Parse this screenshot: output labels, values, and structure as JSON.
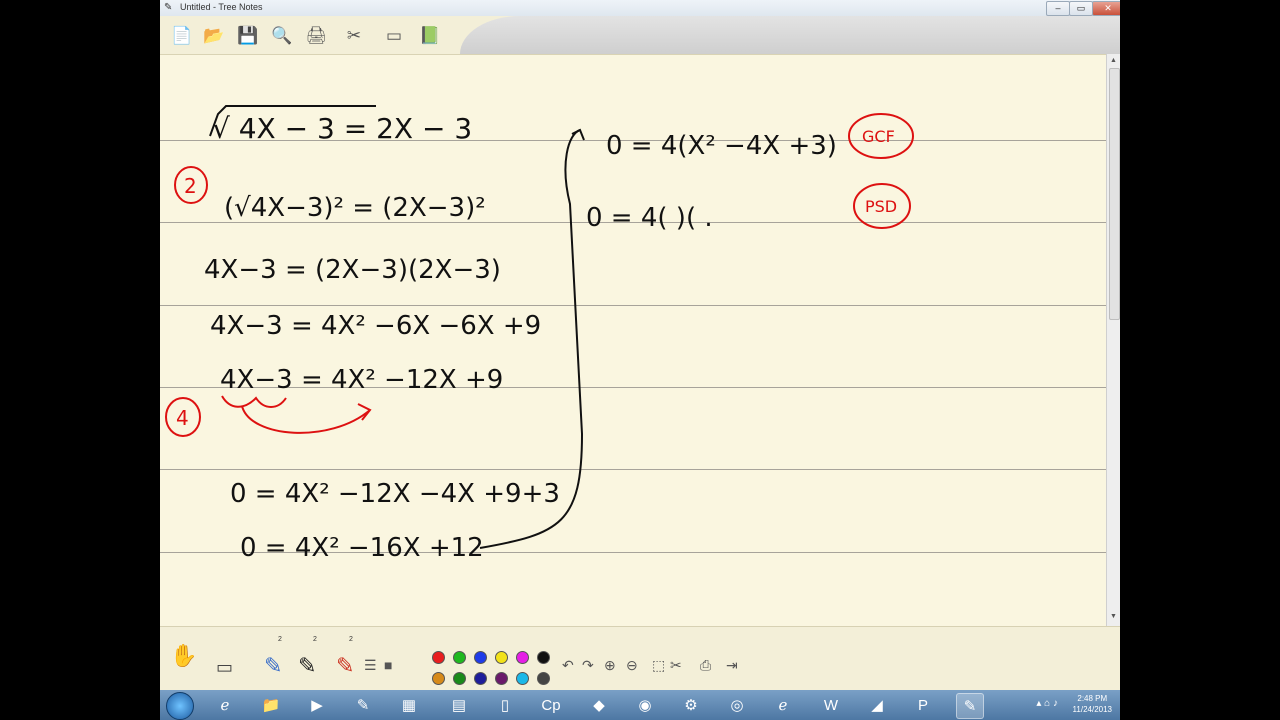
{
  "window": {
    "title": "Untitled - Tree Notes",
    "buttons": {
      "minimize": "–",
      "maximize": "▭",
      "close": "✕"
    }
  },
  "toolbar": [
    {
      "name": "new-file-button",
      "icon": "📄"
    },
    {
      "name": "open-folder-button",
      "icon": "📂"
    },
    {
      "name": "save-button",
      "icon": "💾"
    },
    {
      "name": "print-preview-button",
      "icon": "🔍"
    },
    {
      "name": "print-button",
      "icon": "🖨"
    },
    {
      "name": "screen-capture-button",
      "icon": "✂"
    },
    {
      "name": "window-button",
      "icon": "▭"
    },
    {
      "name": "export-button",
      "icon": "📗"
    }
  ],
  "notes": {
    "left": [
      "√ 4X − 3 = 2X − 3",
      "(√4X−3)² = (2X−3)²",
      "4X−3 = (2X−3)(2X−3)",
      "4X−3 = 4X² −6X −6X +9",
      "4X−3 = 4X² −12X +9",
      "0 = 4X² −12X −4X +9+3",
      "0 = 4X² −16X +12"
    ],
    "right": [
      "0 = 4(X² −4X +3)",
      "0 = 4(    )(    ."
    ],
    "annotations": {
      "step_a": "2",
      "step_b": "4",
      "gcf": "GCF",
      "psd": "PSD"
    }
  },
  "palette": {
    "pen_sizes": [
      "2",
      "2",
      "2"
    ],
    "swatches": [
      "#000000",
      "#e81e1e",
      "#1fb81f",
      "#1f3ce8",
      "#f2e21a",
      "#e51ee5",
      "#111111",
      "#d68a1a",
      "#1a8a1a",
      "#1e1e9a",
      "#6a1a6a",
      "#1ab8e8",
      "#8a8a1a",
      "#444444"
    ]
  },
  "taskbar": {
    "time": "2:48 PM",
    "date": "11/24/2013",
    "apps": [
      "ie",
      "explorer",
      "media",
      "tree-notes-pen",
      "archive",
      "calculator",
      "phone",
      "captivate",
      "tool",
      "chrome",
      "network",
      "camera",
      "ie2",
      "word",
      "notes",
      "powerpoint",
      "pen-active"
    ]
  }
}
